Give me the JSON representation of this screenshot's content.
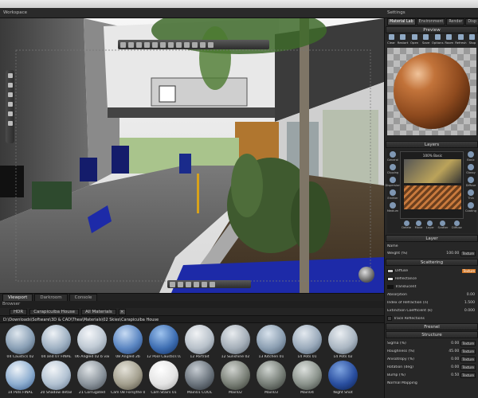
{
  "window": {
    "title": "Workspace",
    "settings_title": "Settings"
  },
  "settings": {
    "tabs": [
      "Material Lab",
      "Environment",
      "Render",
      "Disp"
    ],
    "preview": {
      "header": "Preview",
      "tools": [
        "Clear",
        "Restart",
        "Open",
        "Save",
        "Options",
        "Room",
        "Refresh",
        "Stop"
      ]
    },
    "layers": {
      "header": "Layers",
      "layer_label": "100% Basic",
      "left_buttons": [
        "General",
        "Clipping",
        "Dispersion",
        "Emitter",
        "Medium"
      ],
      "right_buttons": [
        "Basic",
        "Glossy",
        "Diffuse",
        "Thin",
        "Coating"
      ],
      "bottom_buttons": [
        "Delete",
        "Move",
        "Layer",
        "Scatter",
        "Diffuse"
      ]
    },
    "layer_section": {
      "header": "Layer",
      "name_label": "Name",
      "weight_label": "Weight (%)",
      "weight_value": "100.00"
    },
    "scattering": {
      "header": "Scattering",
      "rows": [
        {
          "label": "Diffuse",
          "value": ""
        },
        {
          "label": "Reflectance",
          "value": ""
        },
        {
          "label": "Translucent",
          "value": ""
        },
        {
          "label": "Absorption",
          "value": "0.00"
        },
        {
          "label": "Index of Refraction (n)",
          "value": "1.500"
        },
        {
          "label": "Extinction Coefficient (k)",
          "value": "0.000"
        },
        {
          "label": "Trace Reflections",
          "value": ""
        }
      ]
    },
    "fresnel": {
      "header": "Fresnel"
    },
    "structure": {
      "header": "Structure",
      "rows": [
        {
          "label": "Sigma (%)",
          "value": "0.00"
        },
        {
          "label": "Roughness (%)",
          "value": "45.00"
        },
        {
          "label": "Anisotropy (%)",
          "value": "0.00"
        },
        {
          "label": "Rotation (deg)",
          "value": "0.00"
        },
        {
          "label": "Bump (%)",
          "value": "0.50"
        },
        {
          "label": "Normal Mapping",
          "value": ""
        }
      ],
      "texture_label": "Texture"
    }
  },
  "viewport_tabs": [
    "Viewport",
    "Darkroom",
    "Console"
  ],
  "browser": {
    "title": "Browser",
    "tabs": [
      "HDR",
      "Carapicuiba House",
      "All Materials"
    ],
    "path": "D:\\Downloads\\Software\\3D & CAD\\Thea\\Materials\\02 Skies\\Carapicuiba House",
    "row1": [
      "04 Caustics 02",
      "04 and 07 FINAL",
      "06 Angled 02 b vari",
      "08 Angled 2b",
      "12 Pool Caustics 02",
      "12 Portrait",
      "12 Sunshine 02",
      "13 Kitchen 01",
      "14 Pots 01",
      "14 Pots 02"
    ],
    "row2": [
      "14 Pots FINAL",
      "20 Shadow detail",
      "21 Corrugated",
      "Cam 08 Forsythe 01",
      "Cam Stairs 01",
      "Main01 COOL",
      "Main02",
      "Main03",
      "Main04",
      "Night Shot"
    ]
  }
}
